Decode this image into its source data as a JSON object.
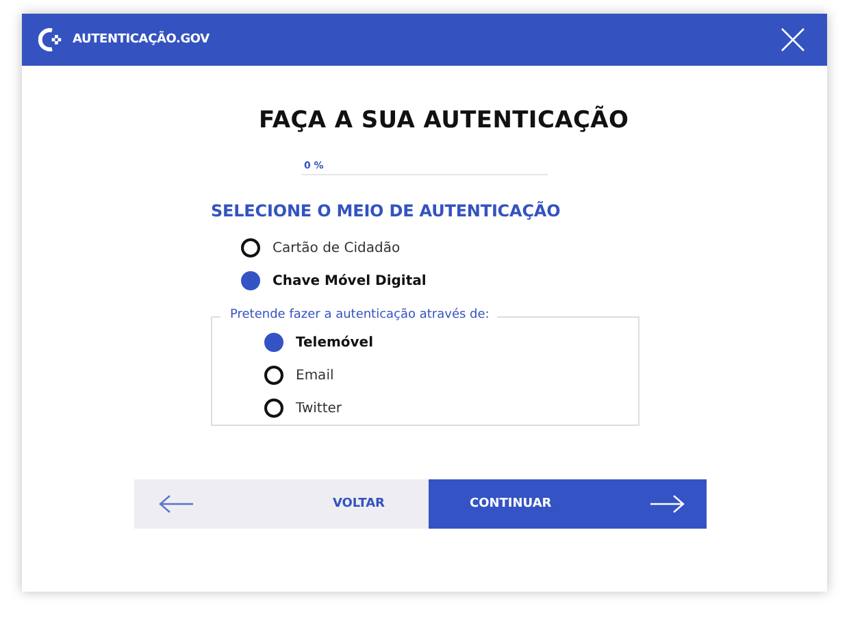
{
  "header": {
    "brand": "AUTENTICAÇÃO.GOV"
  },
  "title": "FAÇA A SUA AUTENTICAÇÃO",
  "progress": {
    "reading": "0 %"
  },
  "method": {
    "heading": "SELECIONE O MEIO DE AUTENTICAÇÃO",
    "options": [
      {
        "label": "Cartão de Cidadão",
        "selected": false
      },
      {
        "label": "Chave Móvel Digital",
        "selected": true
      }
    ]
  },
  "channel": {
    "legend": "Pretende fazer a autenticação através de:",
    "options": [
      {
        "label": "Telemóvel",
        "selected": true
      },
      {
        "label": "Email",
        "selected": false
      },
      {
        "label": "Twitter",
        "selected": false
      }
    ]
  },
  "buttons": {
    "back": "VOLTAR",
    "next": "CONTINUAR"
  }
}
